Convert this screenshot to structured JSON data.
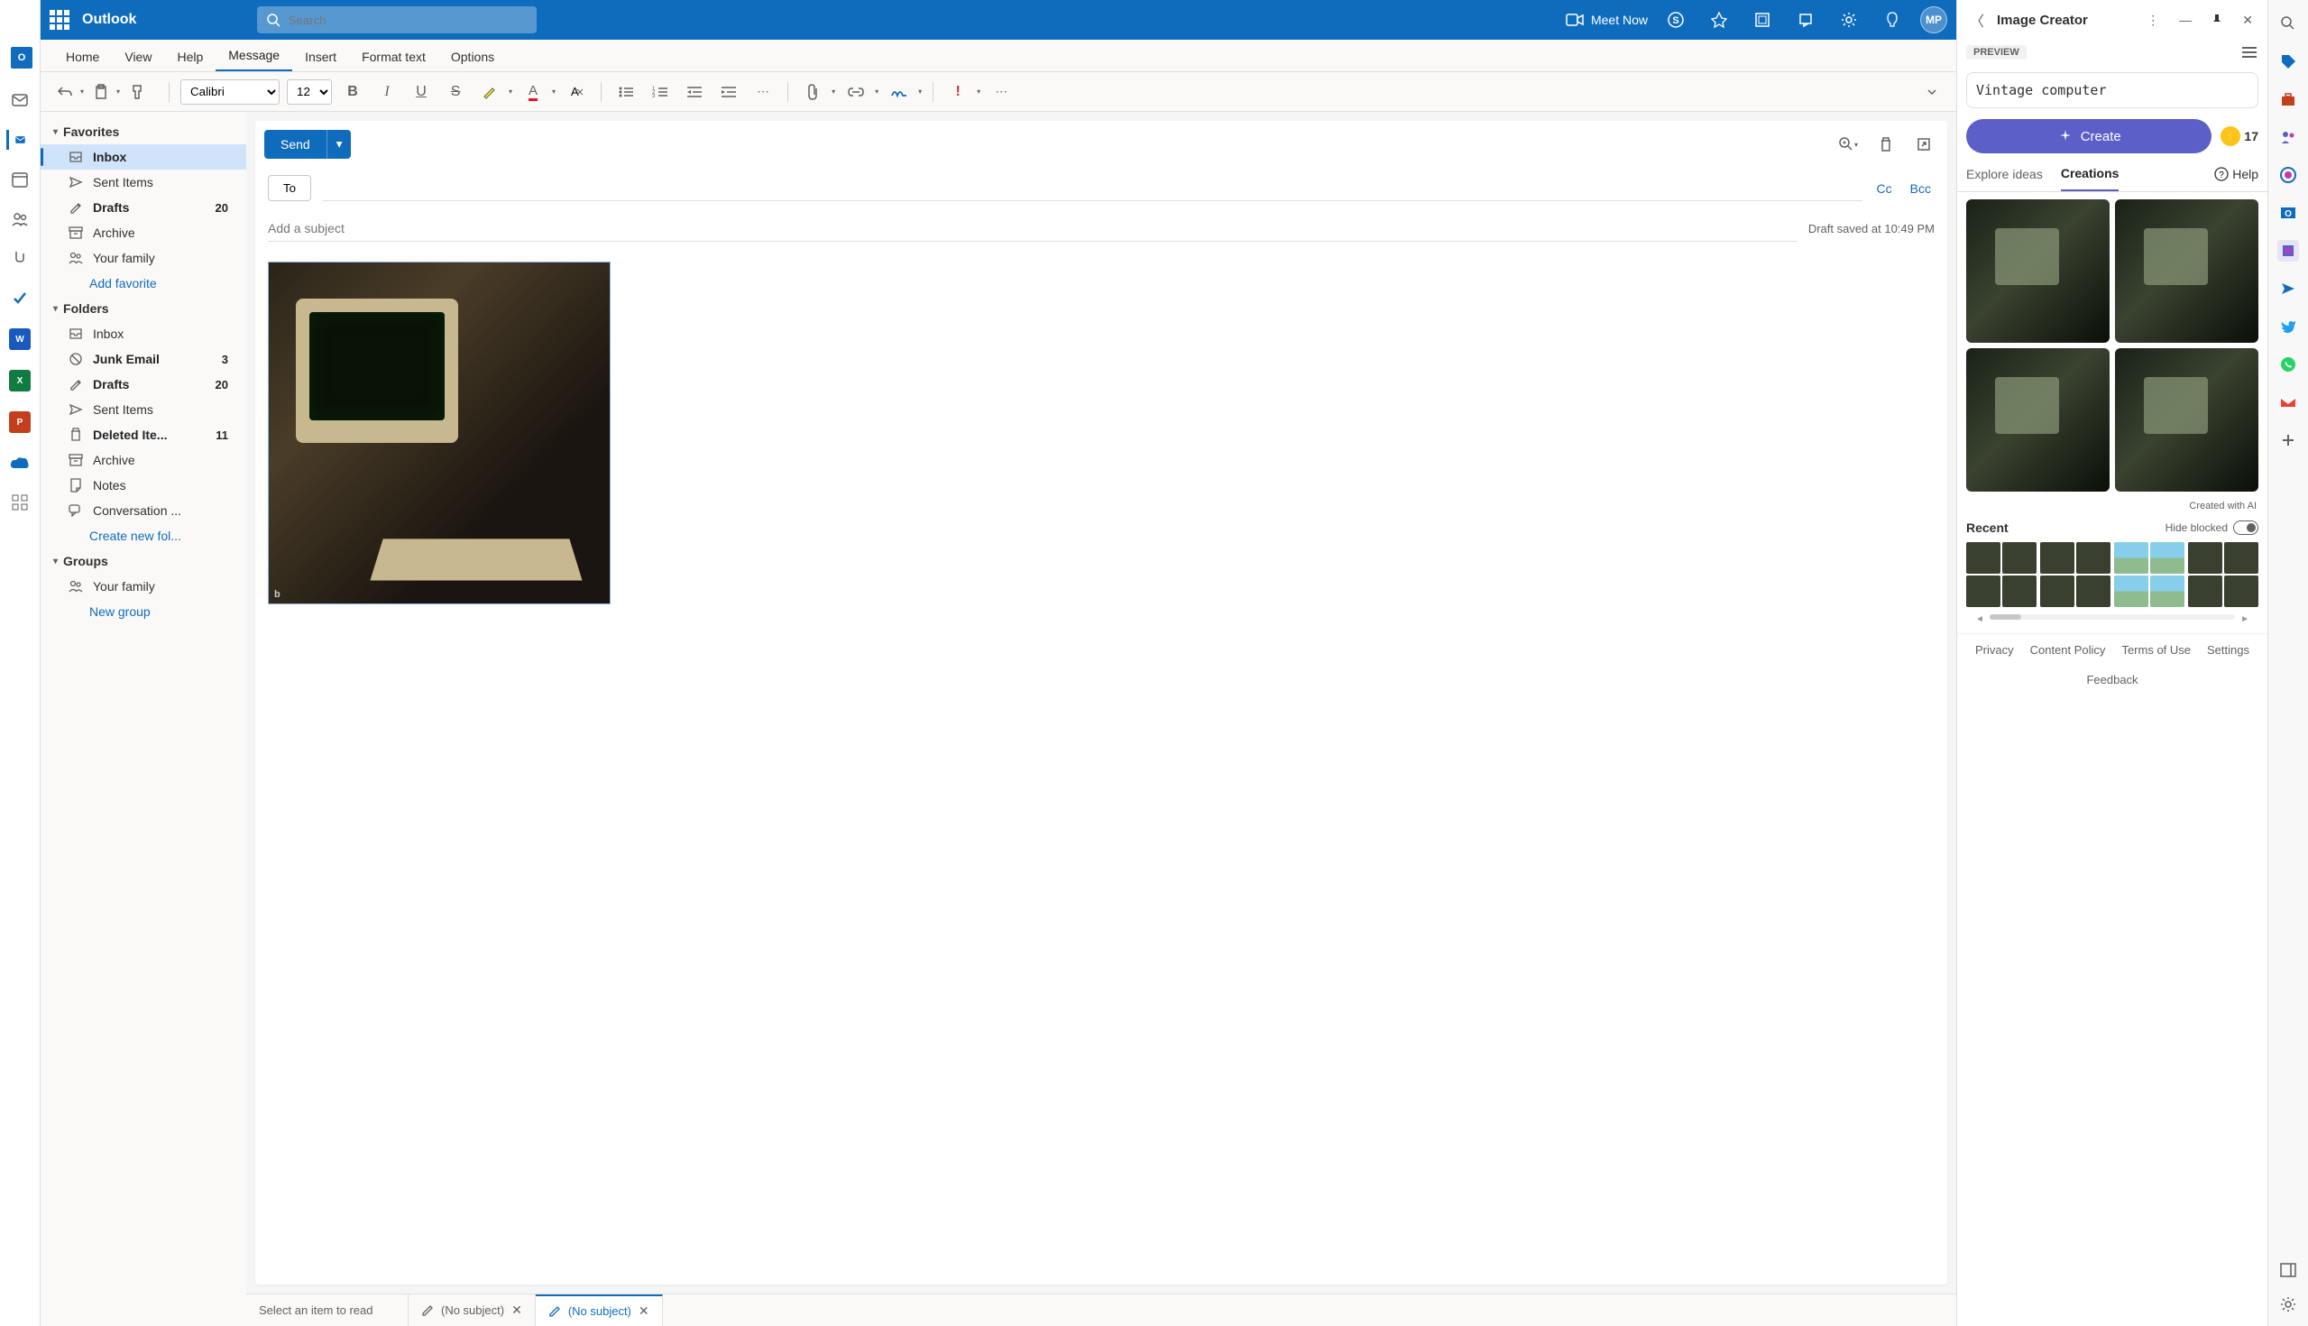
{
  "titlebar": {
    "app_name": "Outlook",
    "search_placeholder": "Search",
    "meet_now": "Meet Now",
    "avatar_initials": "MP"
  },
  "ribbon_tabs": [
    "Home",
    "View",
    "Help",
    "Message",
    "Insert",
    "Format text",
    "Options"
  ],
  "ribbon_active": "Message",
  "toolbar": {
    "font_name": "Calibri",
    "font_size": "12"
  },
  "folders": {
    "favorites_label": "Favorites",
    "folders_label": "Folders",
    "groups_label": "Groups",
    "favorites": [
      {
        "icon": "inbox",
        "label": "Inbox",
        "count": "",
        "selected": true,
        "bold": true
      },
      {
        "icon": "send",
        "label": "Sent Items"
      },
      {
        "icon": "draft",
        "label": "Drafts",
        "count": "20",
        "bold": true
      },
      {
        "icon": "archive",
        "label": "Archive"
      },
      {
        "icon": "people",
        "label": "Your family"
      }
    ],
    "add_favorite": "Add favorite",
    "all": [
      {
        "icon": "inbox",
        "label": "Inbox"
      },
      {
        "icon": "junk",
        "label": "Junk Email",
        "count": "3",
        "bold": true
      },
      {
        "icon": "draft",
        "label": "Drafts",
        "count": "20",
        "bold": true
      },
      {
        "icon": "send",
        "label": "Sent Items"
      },
      {
        "icon": "trash",
        "label": "Deleted Ite...",
        "count": "11",
        "bold": true
      },
      {
        "icon": "archive",
        "label": "Archive"
      },
      {
        "icon": "note",
        "label": "Notes"
      },
      {
        "icon": "conv",
        "label": "Conversation ..."
      }
    ],
    "create_folder": "Create new fol...",
    "groups": [
      {
        "icon": "people",
        "label": "Your family"
      }
    ],
    "new_group": "New group"
  },
  "compose": {
    "send": "Send",
    "to": "To",
    "cc": "Cc",
    "bcc": "Bcc",
    "subject_placeholder": "Add a subject",
    "draft_saved": "Draft saved at 10:49 PM"
  },
  "doc_tabs": {
    "reader": "Select an item to read",
    "tab1": "(No subject)",
    "tab2": "(No subject)"
  },
  "image_creator": {
    "title": "Image Creator",
    "preview": "PREVIEW",
    "prompt": "Vintage computer",
    "create": "Create",
    "boosts": "17",
    "explore": "Explore ideas",
    "creations": "Creations",
    "help": "Help",
    "created_with": "Created with AI",
    "recent": "Recent",
    "hide_blocked": "Hide blocked",
    "links": [
      "Privacy",
      "Content Policy",
      "Terms of Use",
      "Settings",
      "Feedback"
    ]
  }
}
